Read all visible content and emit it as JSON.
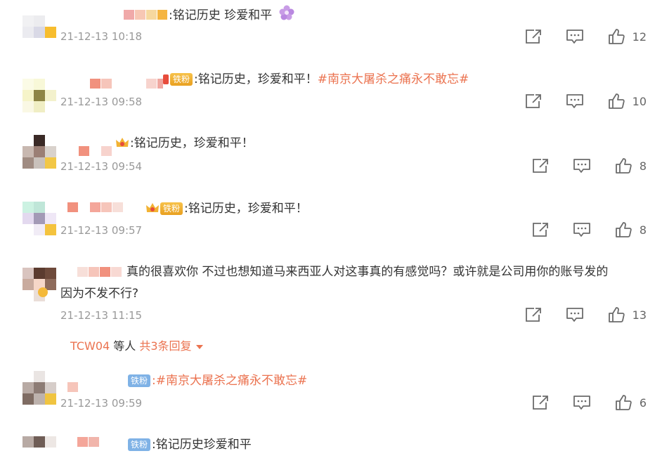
{
  "comments": [
    {
      "text": ":铭记历史 珍爱和平",
      "time": "21-12-13 10:18",
      "likes": "12",
      "emoji_icon": "flower-icon"
    },
    {
      "badge": "铁粉",
      "text": ":铭记历史，珍爱和平！",
      "topic": "#南京大屠杀之痛永不敢忘#",
      "time": "21-12-13 09:58",
      "likes": "10"
    },
    {
      "text": ":铭记历史，珍爱和平！",
      "time": "21-12-13 09:54",
      "likes": "8"
    },
    {
      "badge": "铁粉",
      "text": ":铭记历史，珍爱和平！",
      "time": "21-12-13 09:57",
      "likes": "8"
    },
    {
      "text": "真的很喜欢你 不过也想知道马来西亚人对这事真的有感觉吗？或许就是公司用你的账号发的",
      "text2": "因为不发不行?",
      "time": "21-12-13 11:15",
      "likes": "13",
      "replies_user": "TCW04",
      "replies_mid": " 等人 ",
      "replies_link": "共3条回复"
    },
    {
      "badge": "铁粉",
      "topic": ":#南京大屠杀之痛永不敢忘#",
      "time": "21-12-13 09:59",
      "likes": "6"
    },
    {
      "badge": "铁粉",
      "text": ":铭记历史珍爱和平"
    }
  ]
}
